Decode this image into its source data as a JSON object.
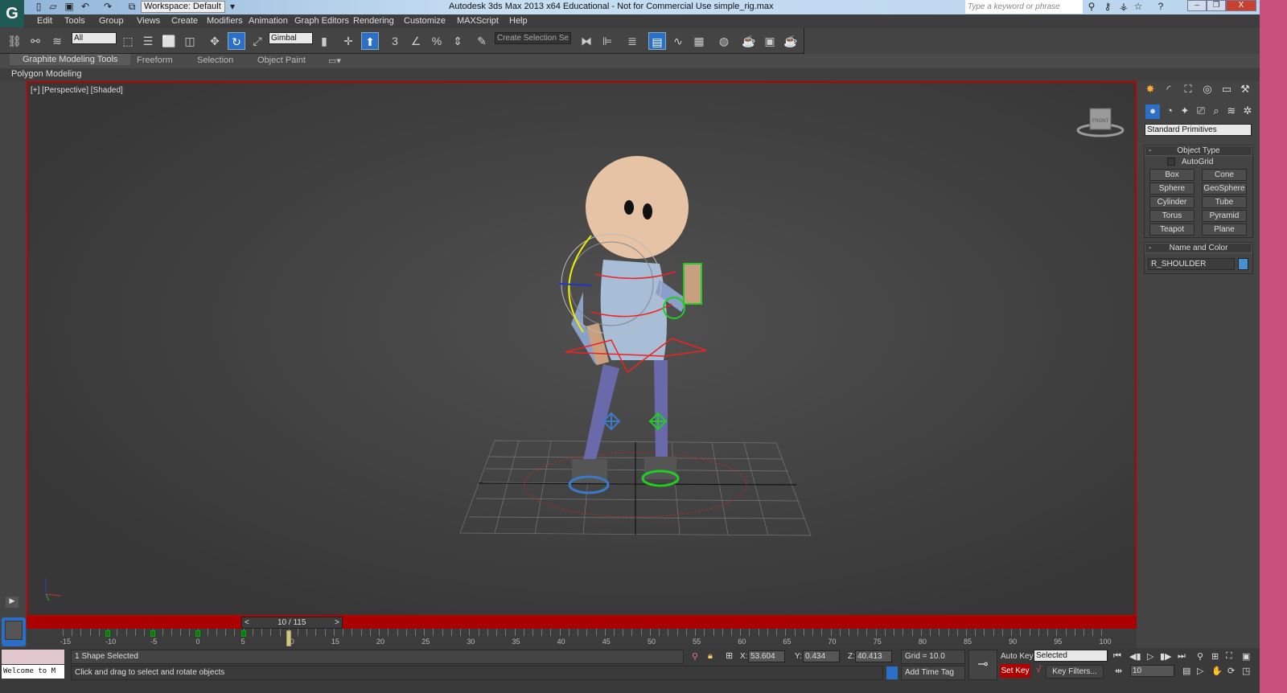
{
  "titlebar": {
    "workspace": "Workspace: Default",
    "app_title": "Autodesk 3ds Max  2013 x64   Educational - Not for Commercial Use    simple_rig.max",
    "search_placeholder": "Type a keyword or phrase",
    "logo": "G"
  },
  "menu": [
    "Edit",
    "Tools",
    "Group",
    "Views",
    "Create",
    "Modifiers",
    "Animation",
    "Graph Editors",
    "Rendering",
    "Customize",
    "MAXScript",
    "Help"
  ],
  "toolbar": {
    "selection_filter": "All",
    "ref_coord": "Gimbal",
    "named_selection": "Create Selection Se",
    "snap_3": "3"
  },
  "ribbon": {
    "tabs": [
      "Graphite Modeling Tools",
      "Freeform",
      "Selection",
      "Object Paint"
    ],
    "panel": "Polygon Modeling"
  },
  "viewport": {
    "label": "[+] [Perspective] [Shaded]",
    "viewcube": "FRONT"
  },
  "command_panel": {
    "category": "Standard Primitives",
    "object_type_title": "Object Type",
    "autogrid": "AutoGrid",
    "buttons": [
      "Box",
      "Cone",
      "Sphere",
      "GeoSphere",
      "Cylinder",
      "Tube",
      "Torus",
      "Pyramid",
      "Teapot",
      "Plane"
    ],
    "name_color_title": "Name and Color",
    "object_name": "R_SHOULDER",
    "object_color": "#4a90d0"
  },
  "timeline": {
    "frame_display": "10 / 115",
    "prev": "<",
    "next": ">",
    "current_frame": 10,
    "key_frames": [
      -10,
      -5,
      0,
      5
    ],
    "labels": [
      "-15",
      "-10",
      "-5",
      "0",
      "5",
      "10",
      "15",
      "20",
      "25",
      "30",
      "35",
      "40",
      "45",
      "50",
      "55",
      "60",
      "65",
      "70",
      "75",
      "80",
      "85",
      "90",
      "95",
      "100"
    ]
  },
  "status": {
    "maxscript": "Welcome to M",
    "selection": "1 Shape Selected",
    "prompt": "Click and drag to select and rotate objects",
    "x_label": "X:",
    "x": "53.604",
    "y_label": "Y:",
    "y": "0.434",
    "z_label": "Z:",
    "z": "40.413",
    "grid": "Grid = 10.0",
    "add_time_tag": "Add Time Tag",
    "auto_key": "Auto Key",
    "set_key": "Set Key",
    "key_mode": "Selected",
    "key_filters": "Key Filters...",
    "frame": "10"
  },
  "colors": {
    "accent": "#2b6fc6",
    "viewport_border": "#b00000",
    "set_key": "#b00000"
  }
}
